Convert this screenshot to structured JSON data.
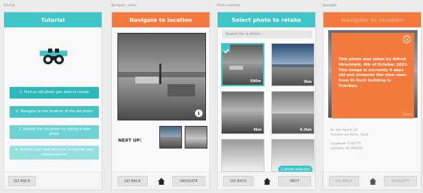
{
  "screens": {
    "tutorial": {
      "caption": "Tutorial",
      "title": "Tutorial",
      "icon": "binoculars-icon",
      "steps": [
        "1. Find an old photo you wish to retake",
        "2. Navigate to the location of the old photo",
        "3. Retake the old photo by taking a new photo",
        "4. Submit your new photo to Smapshot and receive points!"
      ],
      "go_back": "GO BACK"
    },
    "navigate": {
      "caption": "Navigate - route",
      "title": "Navigate to location",
      "next_up": "NEXT UP:",
      "go_back": "GO BACK",
      "navigate": "NAVIGATE"
    },
    "select": {
      "caption": "Photo selected",
      "title": "Select photo to retake",
      "search_placeholder": "Search for a photo...",
      "distances": [
        "500m",
        "3km",
        "4km",
        "4.2km"
      ],
      "selected_badge": "1 photo selected",
      "go_back": "GO BACK",
      "next": "NEXT"
    },
    "info": {
      "caption": "Navigate",
      "title": "Navigate to location",
      "popup_text": "This photo was taken by Alfred Hirschfeld, 4th of October 2021. This image is currently 9 days old and presents the view seen from St Roch building in Yverdon.",
      "popup_distance": "500m",
      "address_line1": "Av. des Sports 20",
      "address_line2": "Yverdon-les-Bains, Vaud",
      "longitude": "Longitude: 6.64775",
      "latitude": "Latitude: 46.780828",
      "go_back": "GO BACK",
      "navigate": "NAVIGATE"
    }
  },
  "colors": {
    "teal": "#3fc5c7",
    "orange": "#f47a3e"
  }
}
